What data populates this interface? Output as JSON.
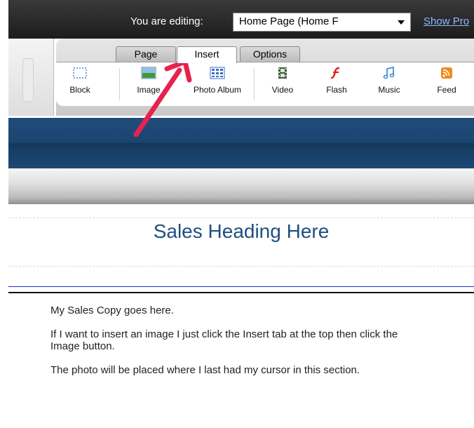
{
  "topbar": {
    "editing_label": "You are editing:",
    "page_select_value": "Home Page (Home F",
    "show_link": "Show Pro"
  },
  "tabs": [
    {
      "label": "Page",
      "active": false
    },
    {
      "label": "Insert",
      "active": true
    },
    {
      "label": "Options",
      "active": false
    }
  ],
  "tools": [
    {
      "label": "Block",
      "icon": "block-icon"
    },
    {
      "label": "Image",
      "icon": "image-icon"
    },
    {
      "label": "Photo Album",
      "icon": "photo-album-icon"
    },
    {
      "label": "Video",
      "icon": "film-icon"
    },
    {
      "label": "Flash",
      "icon": "flash-icon"
    },
    {
      "label": "Music",
      "icon": "music-note-icon"
    },
    {
      "label": "Feed",
      "icon": "rss-icon"
    }
  ],
  "content": {
    "heading": "Sales Heading Here",
    "paragraphs": [
      "My Sales Copy goes here.",
      "If I want to insert an image I just click the Insert tab at the top then click the Image button.",
      "The photo will be placed where I last had my cursor in this section."
    ]
  },
  "colors": {
    "header_blue": "#1c4774",
    "heading_text": "#1f4f80",
    "arrow": "#e8224f",
    "flash_red": "#e02020",
    "feed_orange": "#f08a1c"
  }
}
